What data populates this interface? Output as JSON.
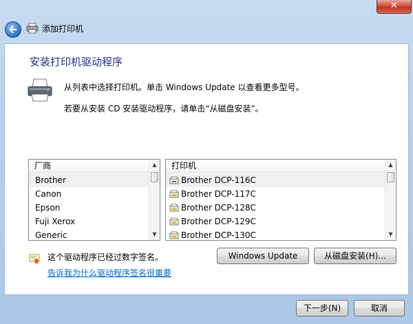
{
  "window": {
    "close_label": "✕"
  },
  "titlebar": {
    "title": "添加打印机"
  },
  "page": {
    "heading": "安装打印机驱动程序",
    "desc1": "从列表中选择打印机。单击 Windows Update 以查看更多型号。",
    "desc2": "若要从安装 CD 安装驱动程序，请单击“从磁盘安装”。"
  },
  "manufacturers": {
    "header": "厂商",
    "items": [
      "Brother",
      "Canon",
      "Epson",
      "Fuji Xerox",
      "Generic"
    ],
    "selected": "Brother"
  },
  "printers": {
    "header": "打印机",
    "items": [
      "Brother DCP-116C",
      "Brother DCP-117C",
      "Brother DCP-128C",
      "Brother DCP-129C",
      "Brother DCP-130C"
    ],
    "selected": "Brother DCP-116C"
  },
  "buttons": {
    "windows_update": "Windows Update",
    "have_disk": "从磁盘安装(H)...",
    "next": "下一步(N)",
    "cancel": "取消"
  },
  "signature": {
    "text": "这个驱动程序已经过数字签名。",
    "link": "告诉我为什么驱动程序签名很重要"
  },
  "icons": {
    "back": "back-arrow-icon",
    "printer": "printer-icon",
    "cert": "certificate-icon"
  }
}
